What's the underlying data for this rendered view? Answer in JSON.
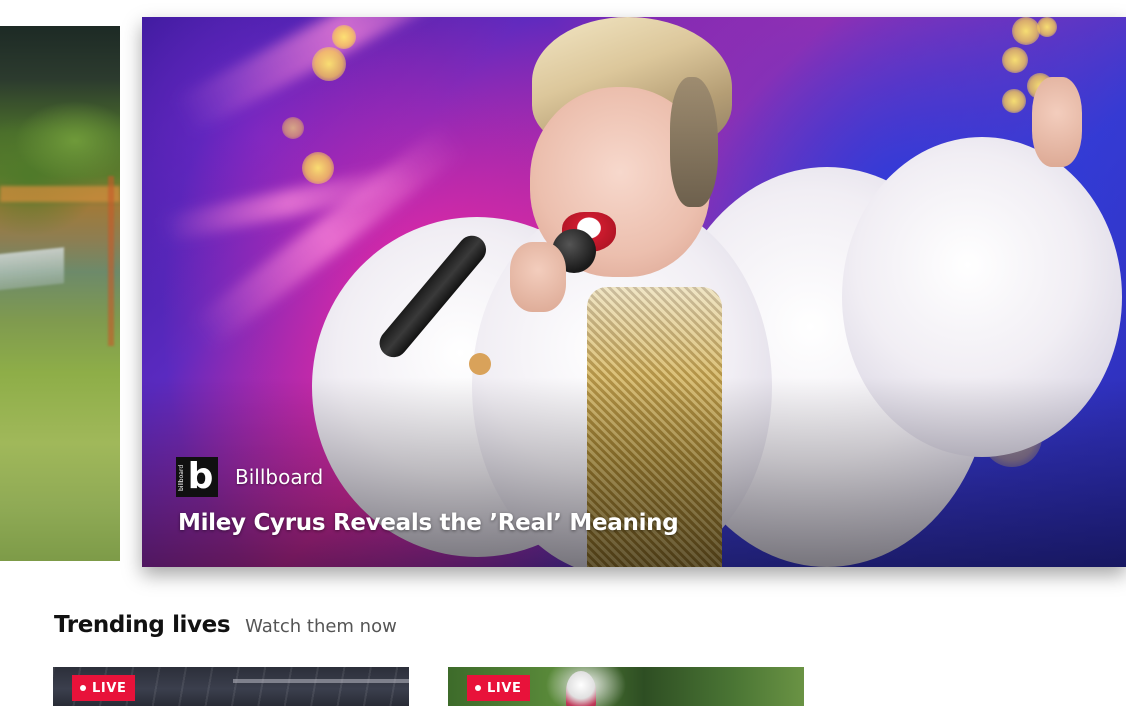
{
  "hero": {
    "source": {
      "name": "Billboard",
      "logo_letter": "b",
      "logo_small_text": "billboard",
      "logo_icon": "billboard-logo-icon"
    },
    "headline": "Miley Cyrus Reveals the ’Real’ Meaning"
  },
  "trending": {
    "title": "Trending lives",
    "subtitle": "Watch them now",
    "cards": [
      {
        "badge": "LIVE",
        "badge_color": "#e8123a"
      },
      {
        "badge": "LIVE",
        "badge_color": "#e8123a"
      }
    ]
  }
}
